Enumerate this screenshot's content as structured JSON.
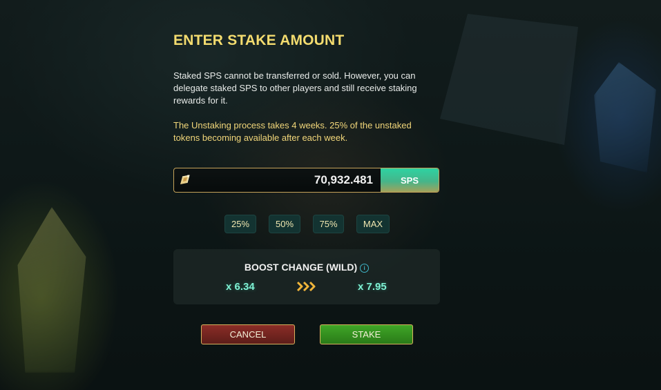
{
  "modal": {
    "title": "ENTER STAKE AMOUNT",
    "description": "Staked SPS cannot be transferred or sold. However, you can delegate staked SPS to other players and still receive staking rewards for it.",
    "unstaking_note": "The Unstaking process takes 4 weeks. 25% of the unstaked tokens becoming available after each week.",
    "amount_input": {
      "value": "70,932.481",
      "unit_label": "SPS",
      "icon": "sps-token-icon"
    },
    "percent_buttons": [
      {
        "label": "25%"
      },
      {
        "label": "50%"
      },
      {
        "label": "75%"
      },
      {
        "label": "MAX"
      }
    ],
    "boost": {
      "title": "BOOST CHANGE (WILD)",
      "info_icon": "info-icon",
      "from": "x 6.34",
      "to": "x 7.95",
      "arrow_icon": "triple-chevron-right-icon"
    },
    "actions": {
      "cancel_label": "CANCEL",
      "stake_label": "STAKE"
    }
  },
  "colors": {
    "title": "#f4dc6f",
    "note": "#f2d77a",
    "boost_value": "#7ff2d4",
    "cancel_bg": "#7a2823",
    "stake_bg": "#369620",
    "border_gold": "#d9b25e",
    "unit_bg": "#2ed3a2"
  }
}
